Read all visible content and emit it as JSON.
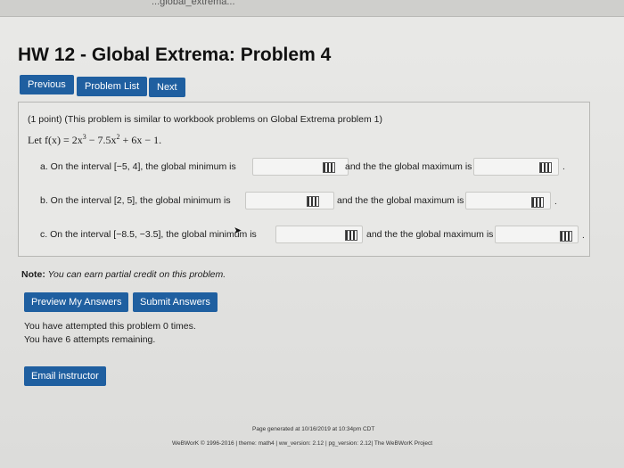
{
  "topbar": {
    "text": "...global_extrema..."
  },
  "page_title": "HW 12 - Global Extrema: Problem 4",
  "nav": {
    "previous": "Previous",
    "problem_list": "Problem List",
    "next": "Next"
  },
  "problem": {
    "intro": "(1 point) (This problem is similar to workbook problems on Global Extrema problem 1)",
    "function_prefix": "Let ",
    "function_text": "f(x) = 2x",
    "function_exp": "3",
    "function_mid": " − 7.5x",
    "function_exp2": "2",
    "function_end": " + 6x − 1.",
    "parts": [
      {
        "label": "a. On the interval [−5, 4], the global minimum is",
        "max_label": "and the the global maximum is",
        "suffix": "."
      },
      {
        "label": "b. On the interval [2, 5], the global minimum is",
        "max_label": "and the the global maximum is",
        "suffix": "."
      },
      {
        "label": "c. On the interval [−8.5, −3.5], the global minimum is",
        "max_label": "and the the global maximum is",
        "suffix": "."
      }
    ]
  },
  "note": {
    "bold": "Note:",
    "text": " You can earn partial credit on this problem."
  },
  "actions": {
    "preview": "Preview My Answers",
    "submit": "Submit Answers",
    "email": "Email instructor"
  },
  "attempts": {
    "line1": "You have attempted this problem 0 times.",
    "line2": "You have 6 attempts remaining."
  },
  "footer": {
    "line1": "Page generated at 10/16/2019 at 10:34pm CDT",
    "line2": "WeBWorK © 1996-2016 | theme: math4 | ww_version: 2.12 | pg_version: 2.12| The WeBWorK Project"
  }
}
